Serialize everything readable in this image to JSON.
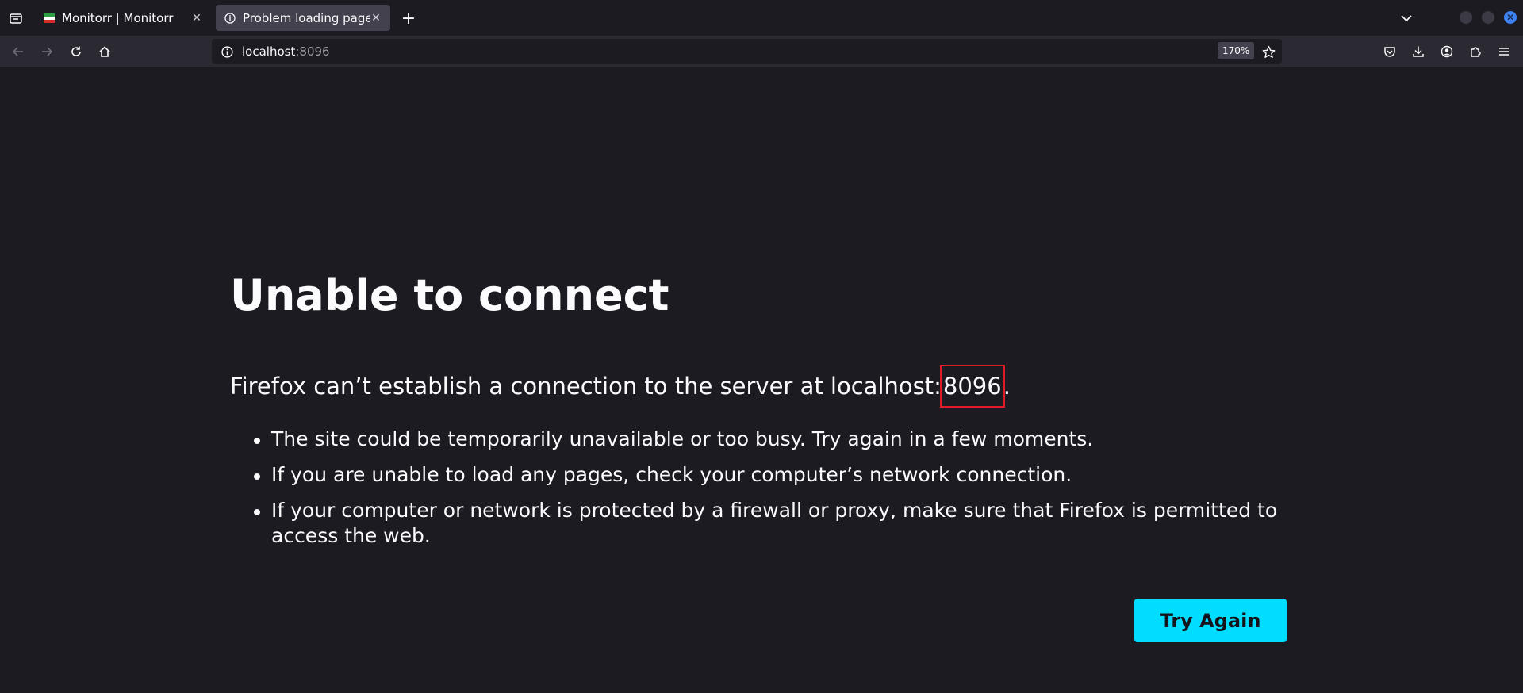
{
  "browser": {
    "tabs": [
      {
        "title": "Monitorr | Monitorr",
        "favicon": "monitorr-favicon",
        "active": false
      },
      {
        "title": "Problem loading page",
        "favicon": "info-icon",
        "active": true
      }
    ],
    "url": {
      "host": "localhost",
      "port": ":8096"
    },
    "zoom": "170%"
  },
  "page": {
    "title": "Unable to connect",
    "lead_prefix": "Firefox can’t establish a connection to the server at localhost:",
    "lead_port": "8096",
    "lead_suffix": ".",
    "reasons": [
      "The site could be temporarily unavailable or too busy. Try again in a few moments.",
      "If you are unable to load any pages, check your computer’s network connection.",
      "If your computer or network is protected by a firewall or proxy, make sure that Firefox is permitted to access the web."
    ],
    "try_again_label": "Try Again"
  },
  "colors": {
    "background": "#1c1b22",
    "button": "#00ddff",
    "highlight": "#e01b24"
  }
}
